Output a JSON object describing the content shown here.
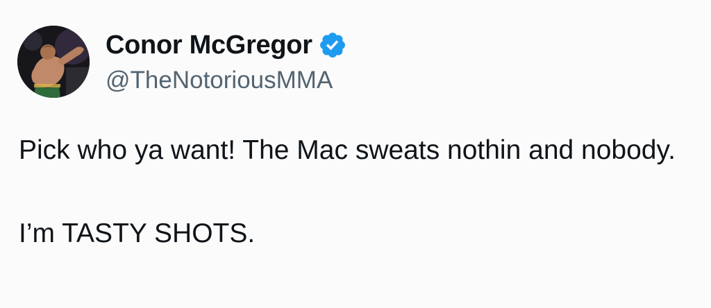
{
  "tweet": {
    "author": {
      "display_name": "Conor McGregor",
      "handle": "@TheNotoriousMMA",
      "verified": true,
      "verified_icon": "verified-badge-icon",
      "verified_color": "#1d9bf0"
    },
    "text": {
      "paragraph_1": "Pick who ya want! The Mac sweats nothin and nobody.",
      "paragraph_2": "I’m TASTY SHOTS."
    }
  },
  "colors": {
    "background": "#fbfbfb",
    "primary_text": "#0f1419",
    "secondary_text": "#536471"
  }
}
